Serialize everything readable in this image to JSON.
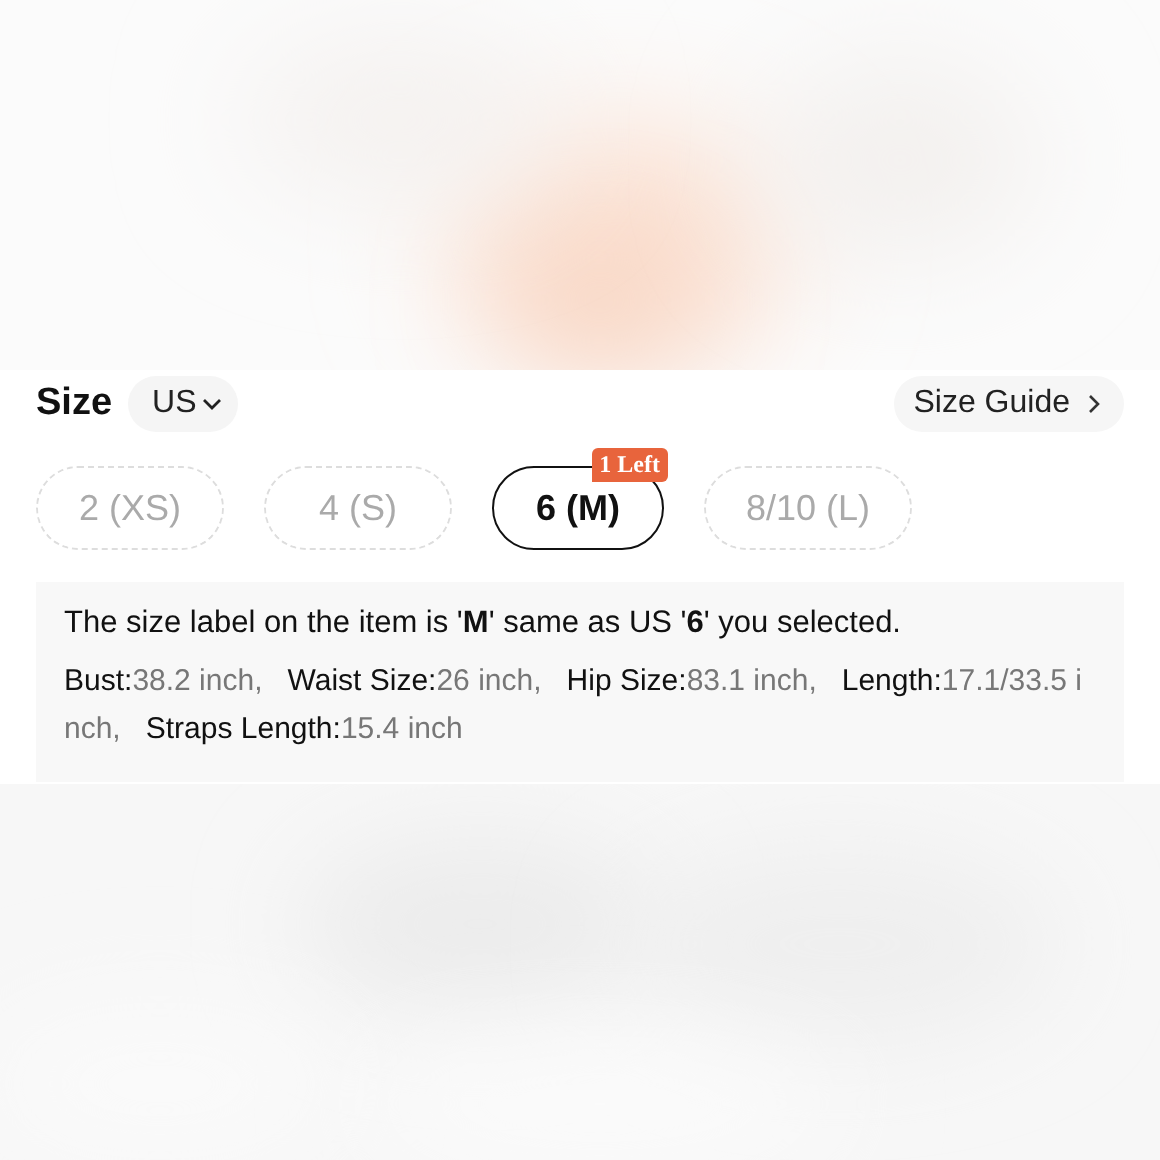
{
  "size_header": {
    "title": "Size",
    "region": "US",
    "guide": "Size Guide"
  },
  "sizes": [
    {
      "label": "2 (XS)",
      "available": false,
      "selected": false
    },
    {
      "label": "4 (S)",
      "available": false,
      "selected": false
    },
    {
      "label": "6 (M)",
      "available": true,
      "selected": true,
      "badge": "1 Left"
    },
    {
      "label": "8/10 (L)",
      "available": false,
      "selected": false
    }
  ],
  "info": {
    "note": "The size label on the item is '**M**' same as US '**6**' you selected.",
    "measurements": [
      {
        "label": "Bust:",
        "value": "38.2 inch,"
      },
      {
        "label": "Waist Size:",
        "value": "26 inch,"
      },
      {
        "label": "Hip Size:",
        "value": "83.1 inch,"
      },
      {
        "label": "Length:",
        "value": "17.1/33.5 inch,"
      },
      {
        "label": "Straps Length:",
        "value": "15.4 inch"
      }
    ]
  }
}
